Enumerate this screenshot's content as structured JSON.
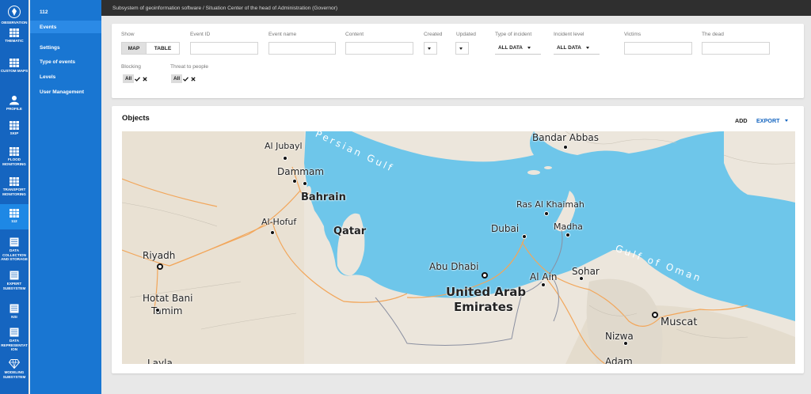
{
  "rail": [
    {
      "key": "observation",
      "label": "OBSERVATION",
      "icon": "seal-icon"
    },
    {
      "key": "thematic",
      "label": "THEMATIC",
      "icon": "grid-icon"
    },
    {
      "key": "custom_maps",
      "label": "CUSTOM MAPS",
      "icon": "grid-icon"
    },
    {
      "key": "profile",
      "label": "PROFILE",
      "icon": "person-icon"
    },
    {
      "key": "skip",
      "label": "SKIP",
      "icon": "grid-icon"
    },
    {
      "key": "flood",
      "label": "FLOOD\nMONITORING",
      "icon": "grid-icon"
    },
    {
      "key": "transport",
      "label": "TRANSPORT\nMONITORING",
      "icon": "grid-icon"
    },
    {
      "key": "n112",
      "label": "112",
      "icon": "grid-icon"
    },
    {
      "key": "data_collection",
      "label": "DATA\nCOLLECTION\nAND STORAGE",
      "icon": "document-icon"
    },
    {
      "key": "expert",
      "label": "EXPERT\nSUBSYSTEM",
      "icon": "document-icon"
    },
    {
      "key": "nsi",
      "label": "NSI",
      "icon": "document-icon"
    },
    {
      "key": "data_repr",
      "label": "DATA\nREPRESENTAT\nION",
      "icon": "document-icon"
    },
    {
      "key": "modeling",
      "label": "MODELING\nSUBSYSTEM",
      "icon": "diamond-icon"
    }
  ],
  "submenu": {
    "title": "112",
    "items": [
      "Events",
      "Settings",
      "Type of events",
      "Levels",
      "User Management"
    ]
  },
  "topbar": {
    "breadcrumb": "Subsystem of geoinformation software / Situation Center of the head of Administration (Governor)"
  },
  "filters": {
    "show_label": "Show",
    "map": "MAP",
    "table": "TABLE",
    "event_id": "Event ID",
    "event_name": "Event name",
    "content": "Content",
    "created": "Created",
    "updated": "Updated",
    "type_label": "Type of incident",
    "type_value": "ALL DATA",
    "level_label": "Incident level",
    "level_value": "ALL DATA",
    "victims": "Victims",
    "dead": "The dead",
    "blocking": "Blocking",
    "threat": "Threat to people",
    "all": "All"
  },
  "objects": {
    "title": "Objects",
    "add": "ADD",
    "export": "EXPORT"
  },
  "map": {
    "labels": [
      "Al Jubayl",
      "Dammam",
      "Bahrain",
      "Al-Hofuf",
      "Qatar",
      "Riyadh",
      "Hotat Bani",
      "Tamim",
      "Layla",
      "Bandar Abbas",
      "Ras Al Khaimah",
      "Dubai",
      "Madha",
      "Abu Dhabi",
      "Al Ain",
      "United Arab",
      "Emirates",
      "Sohar",
      "Muscat",
      "Nizwa",
      "Adam",
      "Persian Gulf",
      "Gulf of Oman"
    ]
  },
  "colors": {
    "rail": "#1565c0",
    "submenu": "#1976d2",
    "water": "#6ec6ea",
    "land": "#ece6dc",
    "road": "#f2a65a"
  }
}
